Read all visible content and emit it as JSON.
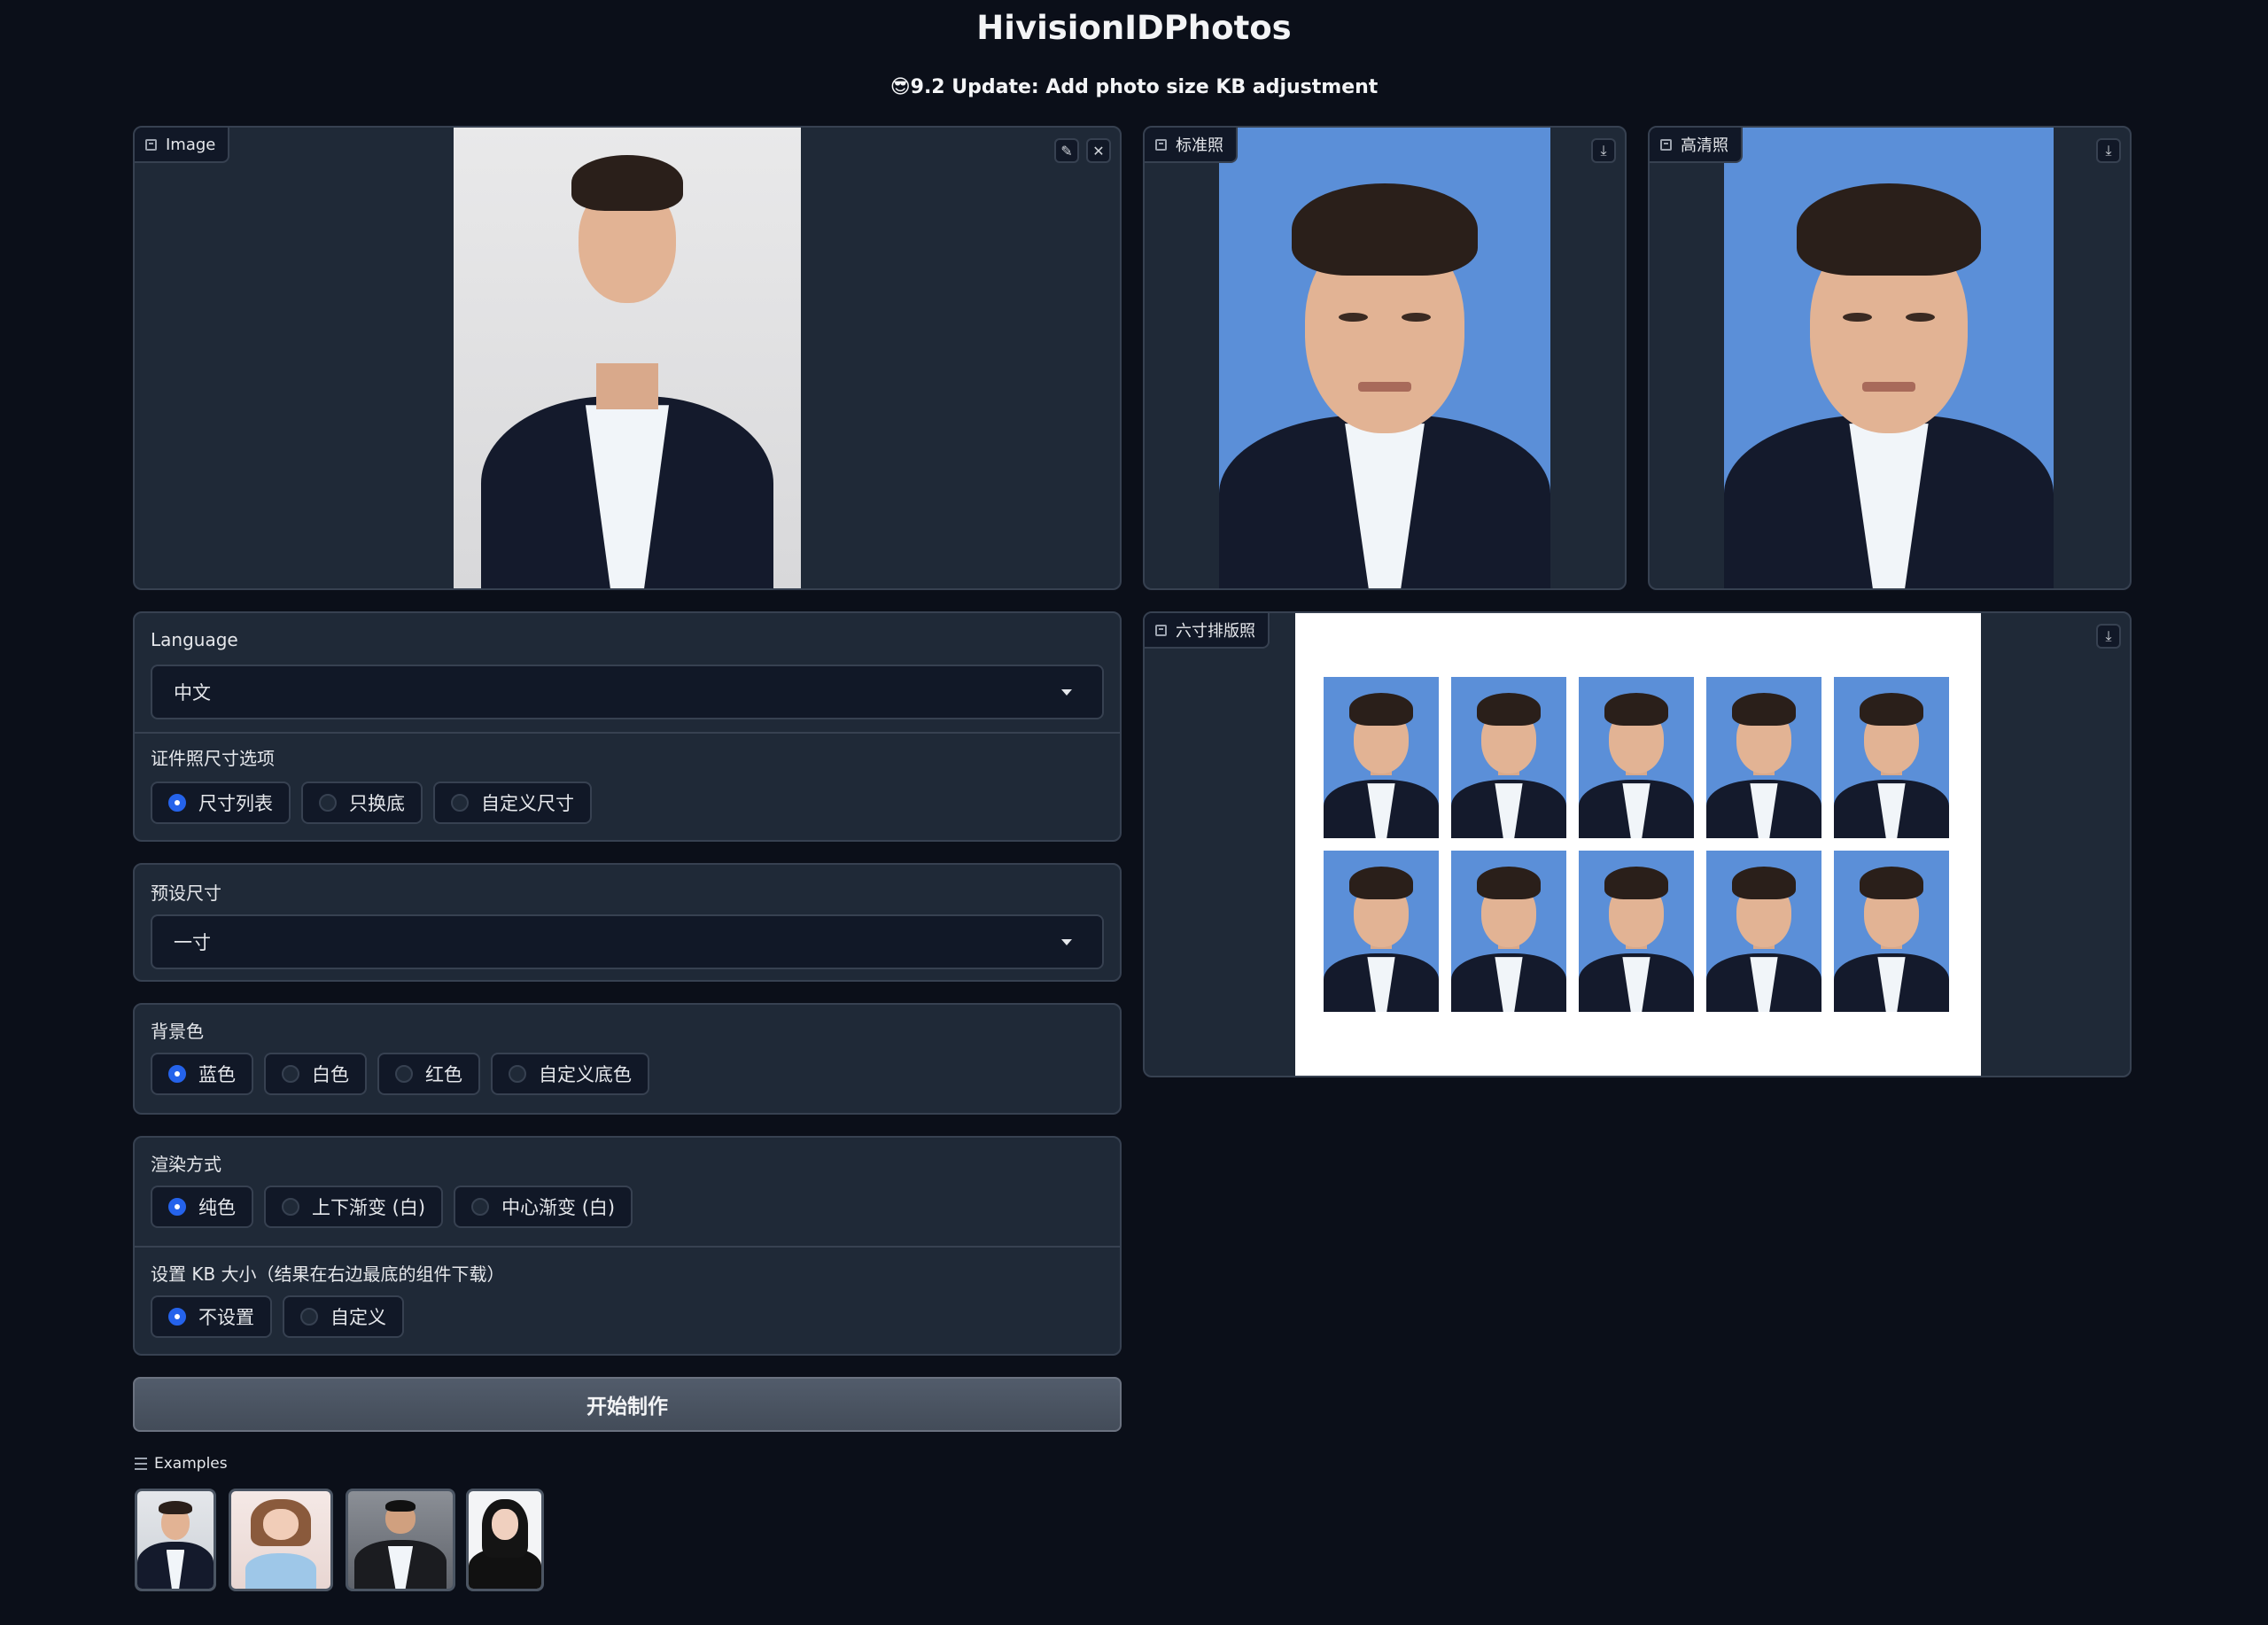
{
  "header": {
    "title": "HivisionIDPhotos",
    "subtitle": "😎9.2 Update: Add photo size KB adjustment"
  },
  "input_image": {
    "label": "Image"
  },
  "outputs": {
    "standard_label": "标准照",
    "hd_label": "高清照",
    "layout_label": "六寸排版照",
    "photo_background_color": "#5b8fd8"
  },
  "language": {
    "label": "Language",
    "value": "中文"
  },
  "size_option": {
    "label": "证件照尺寸选项",
    "options": [
      "尺寸列表",
      "只换底",
      "自定义尺寸"
    ],
    "selected": "尺寸列表"
  },
  "preset_size": {
    "label": "预设尺寸",
    "value": "一寸"
  },
  "background_color": {
    "label": "背景色",
    "options": [
      "蓝色",
      "白色",
      "红色",
      "自定义底色"
    ],
    "selected": "蓝色"
  },
  "render_mode": {
    "label": "渲染方式",
    "options": [
      "纯色",
      "上下渐变 (白)",
      "中心渐变 (白)"
    ],
    "selected": "纯色"
  },
  "kb_size": {
    "label": "设置 KB 大小（结果在右边最底的组件下载）",
    "options": [
      "不设置",
      "自定义"
    ],
    "selected": "不设置"
  },
  "start_button": "开始制作",
  "examples": {
    "label": "Examples"
  },
  "colors": {
    "accent": "#2563eb",
    "background": "#0b0f19",
    "panel": "#1f2937",
    "border": "#374151"
  },
  "icons": [
    "image-icon",
    "edit-icon",
    "close-icon",
    "download-icon",
    "list-icon",
    "chevron-down-icon",
    "radio-icon"
  ]
}
